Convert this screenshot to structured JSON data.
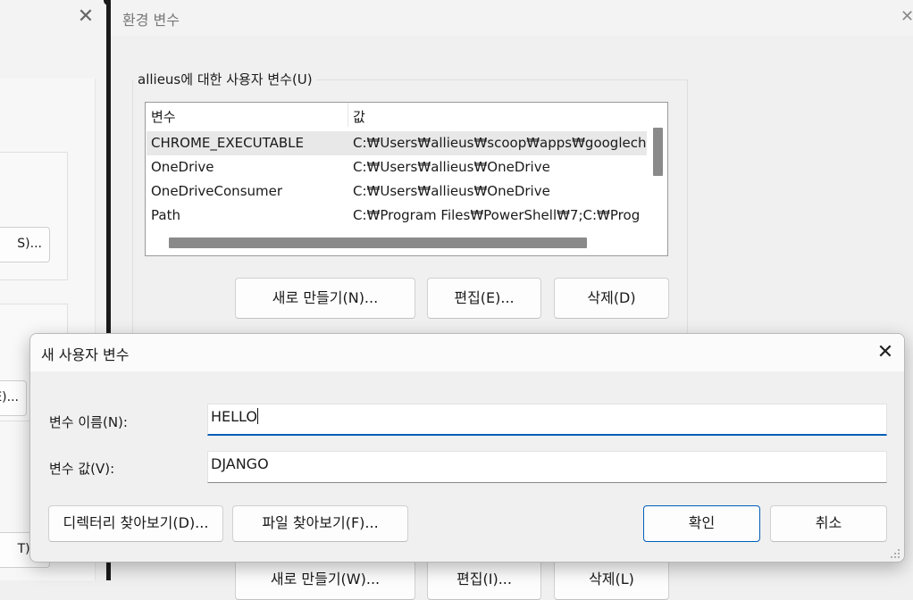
{
  "background_window": {
    "buttons": [
      "S)...",
      "E)...",
      "T)..."
    ]
  },
  "env_window": {
    "title": "환경 변수",
    "user_group_label": "allieus에 대한 사용자 변수(U)",
    "columns": [
      "변수",
      "값"
    ],
    "rows": [
      {
        "name": "CHROME_EXECUTABLE",
        "value": "C:₩Users₩allieus₩scoop₩apps₩googlech"
      },
      {
        "name": "OneDrive",
        "value": "C:₩Users₩allieus₩OneDrive"
      },
      {
        "name": "OneDriveConsumer",
        "value": "C:₩Users₩allieus₩OneDrive"
      },
      {
        "name": "Path",
        "value": "C:₩Program Files₩PowerShell₩7;C:₩Prog"
      }
    ],
    "user_buttons": {
      "new": "새로 만들기(N)...",
      "edit": "편집(E)...",
      "delete": "삭제(D)"
    },
    "system_buttons": {
      "new": "새로 만들기(W)...",
      "edit": "편집(I)...",
      "delete": "삭제(L)"
    }
  },
  "dialog": {
    "title": "새 사용자 변수",
    "name_label": "변수 이름(N):",
    "name_value": "HELLO",
    "value_label": "변수 값(V):",
    "value_value": "DJANGO",
    "browse_dir": "디렉터리 찾아보기(D)...",
    "browse_file": "파일 찾아보기(F)...",
    "ok": "확인",
    "cancel": "취소"
  },
  "colors": {
    "accent": "#005fb8",
    "divider": "#1b1b1b"
  }
}
